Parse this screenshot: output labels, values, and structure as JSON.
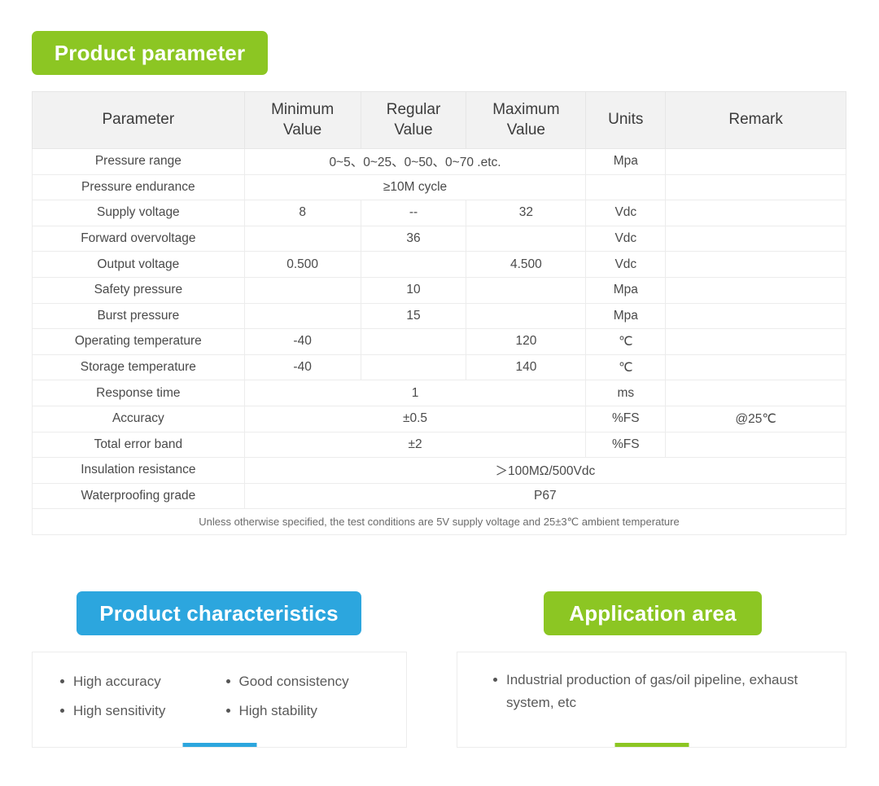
{
  "sections": {
    "parameter_title": "Product parameter",
    "characteristics_title": "Product characteristics",
    "application_title": "Application area"
  },
  "colors": {
    "green": "#8cc623",
    "blue": "#2ca6de",
    "header_bg": "#f2f2f2",
    "text": "#4a4a4a"
  },
  "spec_table": {
    "columns": [
      "Parameter",
      "Minimum\nValue",
      "Regular\nValue",
      "Maximum\nValue",
      "Units",
      "Remark"
    ],
    "columns_display": {
      "parameter": "Parameter",
      "minimum_line1": "Minimum",
      "minimum_line2": "Value",
      "regular_line1": "Regular",
      "regular_line2": "Value",
      "maximum_line1": "Maximum",
      "maximum_line2": "Value",
      "units": "Units",
      "remark": "Remark"
    },
    "rows": [
      {
        "parameter": "Pressure range",
        "merged": "0~5、0~25、0~50、0~70 .etc.",
        "minimum": "",
        "regular": "",
        "maximum": "",
        "units": "Mpa",
        "remark": ""
      },
      {
        "parameter": "Pressure endurance",
        "merged": "≥10M cycle",
        "minimum": "",
        "regular": "",
        "maximum": "",
        "units": "",
        "remark": ""
      },
      {
        "parameter": "Supply voltage",
        "minimum": "8",
        "regular": "--",
        "maximum": "32",
        "units": "Vdc",
        "remark": ""
      },
      {
        "parameter": "Forward overvoltage",
        "minimum": "",
        "regular": "36",
        "maximum": "",
        "units": "Vdc",
        "remark": ""
      },
      {
        "parameter": "Output voltage",
        "minimum": "0.500",
        "regular": "",
        "maximum": "4.500",
        "units": "Vdc",
        "remark": ""
      },
      {
        "parameter": "Safety pressure",
        "minimum": "",
        "regular": "10",
        "maximum": "",
        "units": "Mpa",
        "remark": ""
      },
      {
        "parameter": "Burst pressure",
        "minimum": "",
        "regular": "15",
        "maximum": "",
        "units": "Mpa",
        "remark": ""
      },
      {
        "parameter": "Operating temperature",
        "minimum": "-40",
        "regular": "",
        "maximum": "120",
        "units": "℃",
        "remark": ""
      },
      {
        "parameter": "Storage temperature",
        "minimum": "-40",
        "regular": "",
        "maximum": "140",
        "units": "℃",
        "remark": ""
      },
      {
        "parameter": "Response time",
        "merged": "1",
        "minimum": "",
        "regular": "",
        "maximum": "",
        "units": "ms",
        "remark": ""
      },
      {
        "parameter": "Accuracy",
        "merged": "±0.5",
        "minimum": "",
        "regular": "",
        "maximum": "",
        "units": "%FS",
        "remark": "@25℃"
      },
      {
        "parameter": "Total error band",
        "merged": "±2",
        "minimum": "",
        "regular": "",
        "maximum": "",
        "units": "%FS",
        "remark": ""
      },
      {
        "parameter": "Insulation resistance",
        "merged_wide": "＞100MΩ/500Vdc",
        "minimum": "",
        "regular": "",
        "maximum": "",
        "units": "",
        "remark": ""
      },
      {
        "parameter": "Waterproofing grade",
        "merged_wide": "P67",
        "minimum": "",
        "regular": "",
        "maximum": "",
        "units": "",
        "remark": ""
      }
    ],
    "footnote": "Unless otherwise specified, the test conditions are 5V supply voltage and 25±3℃ ambient temperature"
  },
  "characteristics": {
    "items": [
      "High accuracy",
      "Good consistency",
      "High sensitivity",
      "High stability"
    ]
  },
  "application": {
    "items": [
      "Industrial production of gas/oil pipeline, exhaust system, etc"
    ]
  }
}
